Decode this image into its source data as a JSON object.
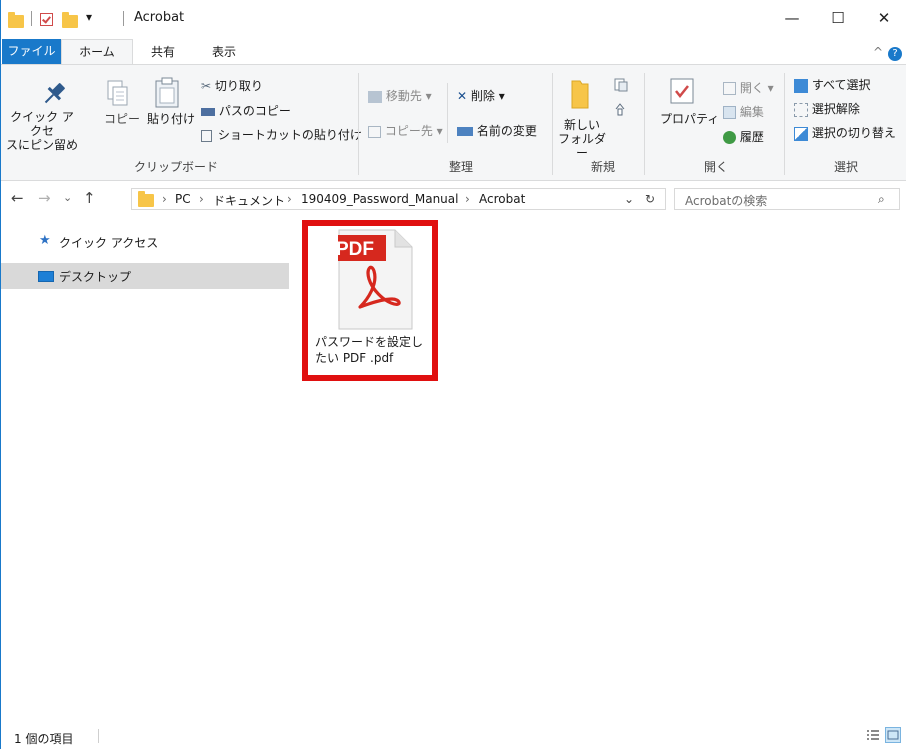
{
  "window": {
    "title": "Acrobat",
    "controls": {
      "minimize": "—",
      "maximize": "☐",
      "close": "✕"
    }
  },
  "quick_access": {
    "dropdown": "▾"
  },
  "ribbon_tabs": {
    "file": "ファイル",
    "home": "ホーム",
    "share": "共有",
    "view": "表示",
    "collapse": "^",
    "help": "?"
  },
  "ribbon": {
    "clipboard": {
      "label": "クリップボード",
      "pin_quick_access": [
        "クイック アクセ",
        "スにピン留め"
      ],
      "copy": "コピー",
      "paste": "貼り付け",
      "cut": "切り取り",
      "copy_path": "パスのコピー",
      "paste_shortcut": "ショートカットの貼り付け"
    },
    "organize": {
      "label": "整理",
      "move_to": "移動先",
      "copy_to": "コピー先",
      "delete": "削除",
      "rename": "名前の変更"
    },
    "new": {
      "label": "新規",
      "new_folder": [
        "新しい",
        "フォルダー"
      ]
    },
    "open": {
      "label": "開く",
      "properties": "プロパティ",
      "open": "開く",
      "edit": "編集",
      "history": "履歴"
    },
    "select": {
      "label": "選択",
      "select_all": "すべて選択",
      "select_none": "選択解除",
      "invert": "選択の切り替え"
    }
  },
  "address": {
    "crumbs": [
      "PC",
      "ドキュメント",
      "190409_Password_Manual",
      "Acrobat"
    ],
    "separator": "›",
    "search_placeholder": "Acrobatの検索"
  },
  "nav_pane": {
    "items": [
      {
        "label": "クイック アクセス"
      },
      {
        "label": "デスクトップ"
      }
    ]
  },
  "files": [
    {
      "name_line1": "パスワードを設定し",
      "name_line2": "たい PDF .pdf",
      "badge": "PDF"
    }
  ],
  "status": {
    "item_count": "1 個の項目"
  },
  "colors": {
    "accent": "#1979ca",
    "highlight": "#e01010",
    "pdf_red": "#d6281e",
    "folder": "#f7c548"
  }
}
